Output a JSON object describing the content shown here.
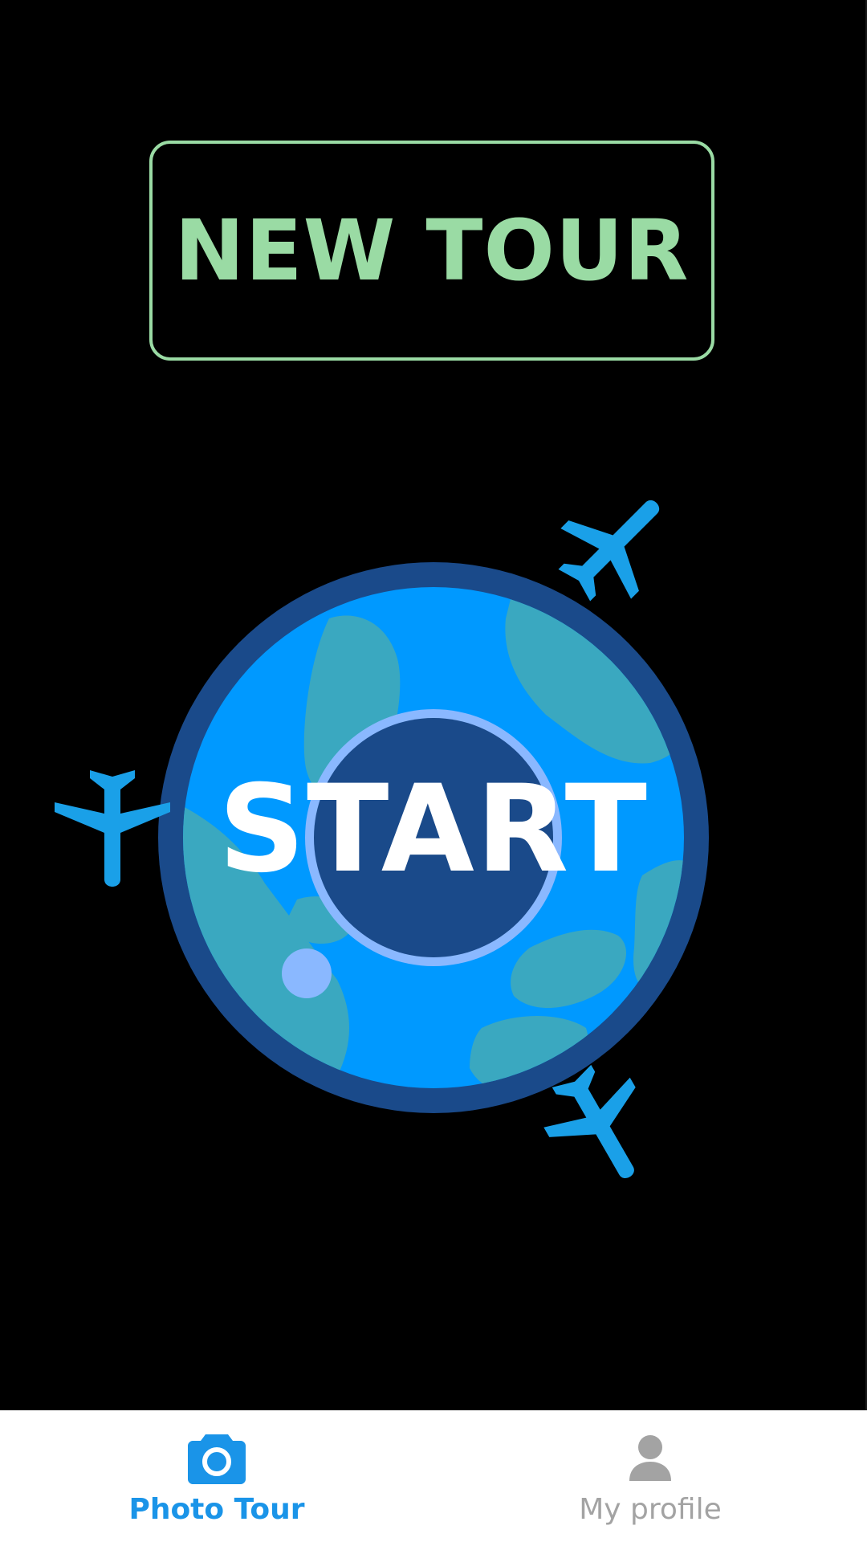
{
  "new_tour": {
    "label": "NEW TOUR"
  },
  "start": {
    "label": "START"
  },
  "nav": {
    "items": [
      {
        "label": "Photo Tour",
        "icon": "camera-icon",
        "active": true
      },
      {
        "label": "My profile",
        "icon": "person-icon",
        "active": false
      }
    ]
  },
  "colors": {
    "background": "#000000",
    "accent_green": "#9adba4",
    "globe_ring": "#1a4a8a",
    "ocean": "#0099ff",
    "land": "#3aa8c0",
    "inner_circle": "#1a4a8a",
    "inner_ring": "#8ab8ff",
    "plane": "#1aa0e8",
    "nav_active": "#1a94e8",
    "nav_inactive": "#a3a3a3"
  }
}
